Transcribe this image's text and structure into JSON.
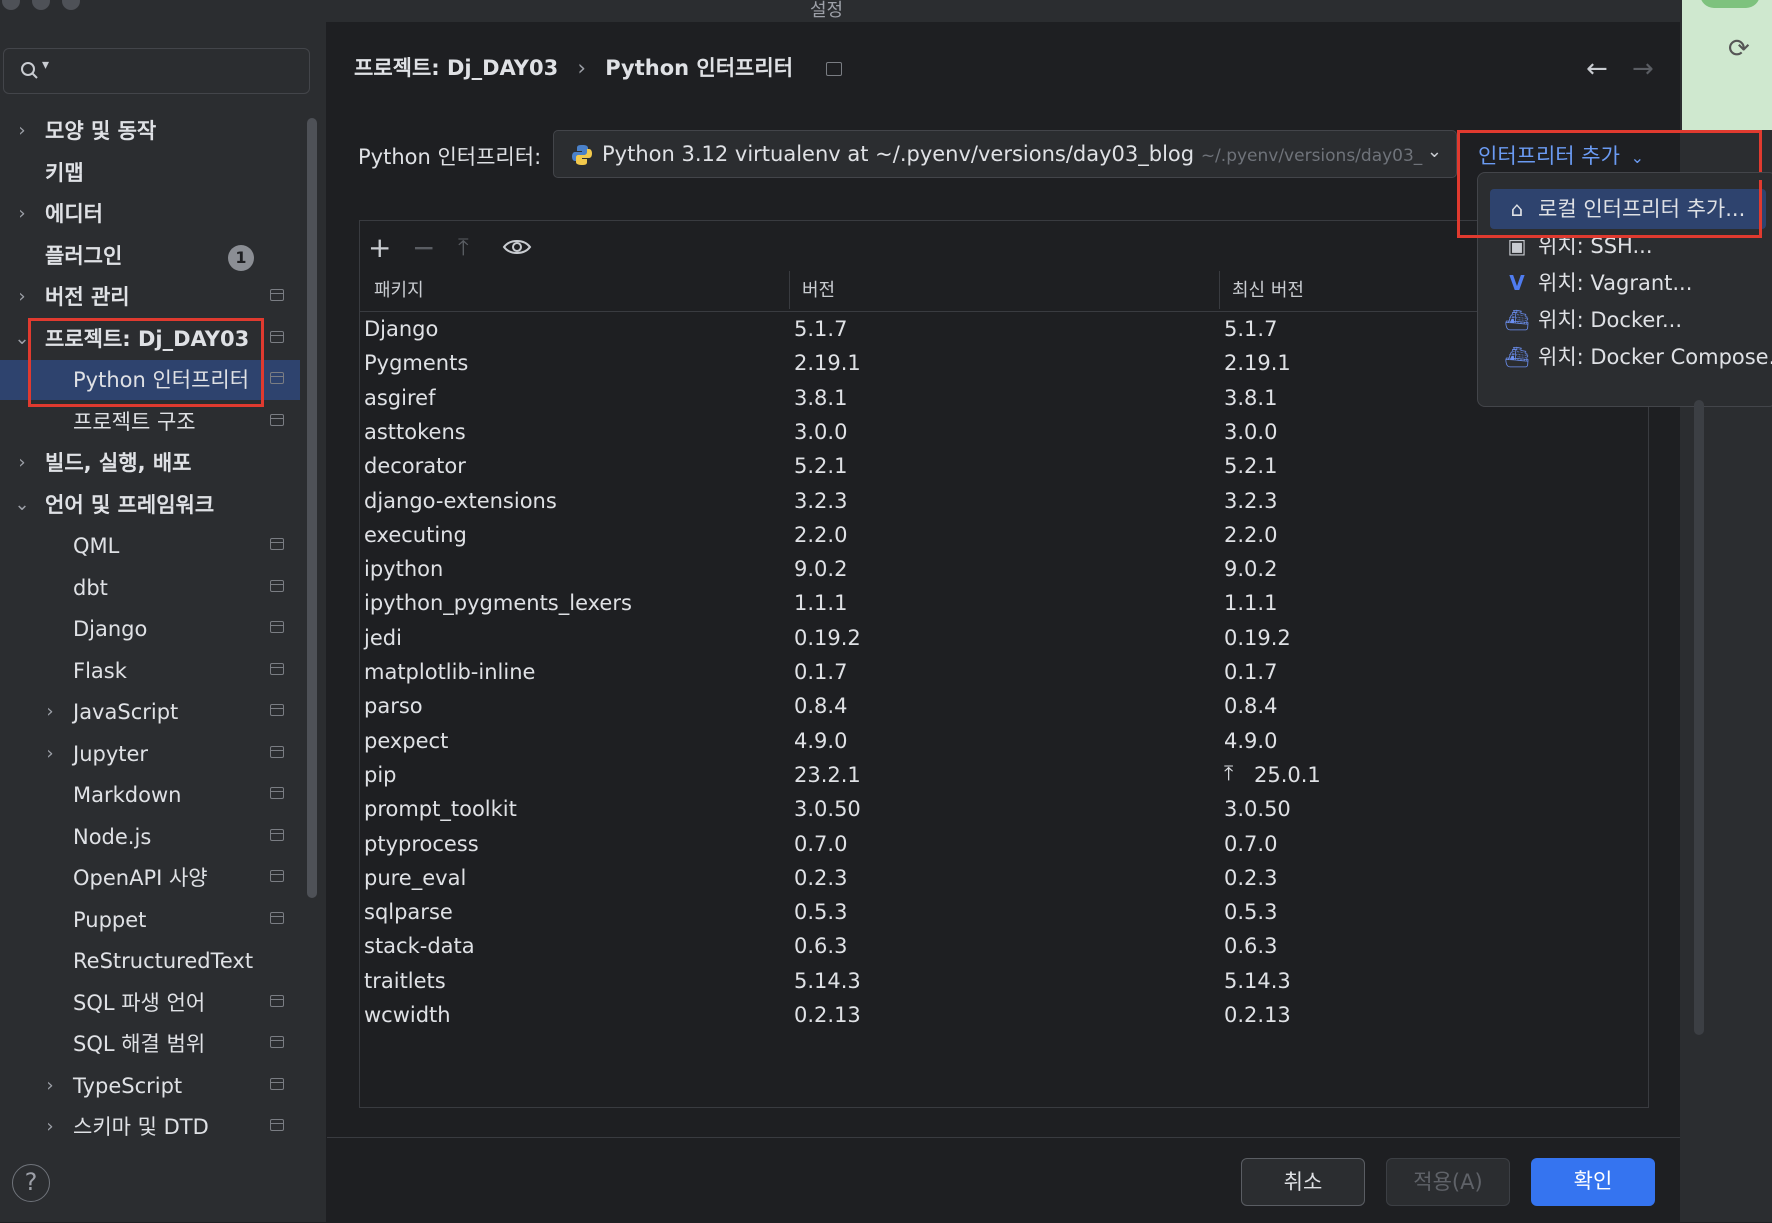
{
  "window": {
    "title": "설정"
  },
  "sidebar": {
    "search_placeholder": "",
    "items": [
      {
        "label": "모양 및 동작",
        "bold": true,
        "expand": "collapsed",
        "indent": 1,
        "project": false
      },
      {
        "label": "키맵",
        "bold": true,
        "expand": "none",
        "indent": 1,
        "project": false
      },
      {
        "label": "에디터",
        "bold": true,
        "expand": "collapsed",
        "indent": 1,
        "project": false
      },
      {
        "label": "플러그인",
        "bold": true,
        "expand": "none",
        "indent": 1,
        "project": false,
        "badge": "1"
      },
      {
        "label": "버전 관리",
        "bold": true,
        "expand": "collapsed",
        "indent": 1,
        "project": true
      },
      {
        "label": "프로젝트: Dj_DAY03",
        "bold": true,
        "expand": "expanded",
        "indent": 1,
        "project": true
      },
      {
        "label": "Python 인터프리터",
        "bold": false,
        "expand": "none",
        "indent": 2,
        "project": true,
        "selected": true
      },
      {
        "label": "프로젝트 구조",
        "bold": false,
        "expand": "none",
        "indent": 2,
        "project": true
      },
      {
        "label": "빌드, 실행, 배포",
        "bold": true,
        "expand": "collapsed",
        "indent": 1,
        "project": false
      },
      {
        "label": "언어 및 프레임워크",
        "bold": true,
        "expand": "expanded",
        "indent": 1,
        "project": false
      },
      {
        "label": "QML",
        "bold": false,
        "expand": "none",
        "indent": 2,
        "project": true
      },
      {
        "label": "dbt",
        "bold": false,
        "expand": "none",
        "indent": 2,
        "project": true
      },
      {
        "label": "Django",
        "bold": false,
        "expand": "none",
        "indent": 2,
        "project": true
      },
      {
        "label": "Flask",
        "bold": false,
        "expand": "none",
        "indent": 2,
        "project": true
      },
      {
        "label": "JavaScript",
        "bold": false,
        "expand": "collapsed",
        "indent": 2,
        "project": true
      },
      {
        "label": "Jupyter",
        "bold": false,
        "expand": "collapsed",
        "indent": 2,
        "project": true
      },
      {
        "label": "Markdown",
        "bold": false,
        "expand": "none",
        "indent": 2,
        "project": true
      },
      {
        "label": "Node.js",
        "bold": false,
        "expand": "none",
        "indent": 2,
        "project": true
      },
      {
        "label": "OpenAPI 사양",
        "bold": false,
        "expand": "none",
        "indent": 2,
        "project": true
      },
      {
        "label": "Puppet",
        "bold": false,
        "expand": "none",
        "indent": 2,
        "project": true
      },
      {
        "label": "ReStructuredText",
        "bold": false,
        "expand": "none",
        "indent": 2,
        "project": false
      },
      {
        "label": "SQL 파생 언어",
        "bold": false,
        "expand": "none",
        "indent": 2,
        "project": true
      },
      {
        "label": "SQL 해결 범위",
        "bold": false,
        "expand": "none",
        "indent": 2,
        "project": true
      },
      {
        "label": "TypeScript",
        "bold": false,
        "expand": "collapsed",
        "indent": 2,
        "project": true
      },
      {
        "label": "스키마 및 DTD",
        "bold": false,
        "expand": "collapsed",
        "indent": 2,
        "project": true
      }
    ]
  },
  "breadcrumb": {
    "project": "프로젝트: Dj_DAY03",
    "separator": "›",
    "page": "Python 인터프리터"
  },
  "interpreter": {
    "label": "Python 인터프리터:",
    "value": "Python 3.12 virtualenv at ~/.pyenv/versions/day03_blog",
    "path_hint": "~/.pyenv/versions/day03_",
    "add_label": "인터프리터 추가"
  },
  "table": {
    "columns": [
      "패키지",
      "버전",
      "최신 버전"
    ],
    "rows": [
      [
        "Django",
        "5.1.7",
        "5.1.7",
        false
      ],
      [
        "Pygments",
        "2.19.1",
        "2.19.1",
        false
      ],
      [
        "asgiref",
        "3.8.1",
        "3.8.1",
        false
      ],
      [
        "asttokens",
        "3.0.0",
        "3.0.0",
        false
      ],
      [
        "decorator",
        "5.2.1",
        "5.2.1",
        false
      ],
      [
        "django-extensions",
        "3.2.3",
        "3.2.3",
        false
      ],
      [
        "executing",
        "2.2.0",
        "2.2.0",
        false
      ],
      [
        "ipython",
        "9.0.2",
        "9.0.2",
        false
      ],
      [
        "ipython_pygments_lexers",
        "1.1.1",
        "1.1.1",
        false
      ],
      [
        "jedi",
        "0.19.2",
        "0.19.2",
        false
      ],
      [
        "matplotlib-inline",
        "0.1.7",
        "0.1.7",
        false
      ],
      [
        "parso",
        "0.8.4",
        "0.8.4",
        false
      ],
      [
        "pexpect",
        "4.9.0",
        "4.9.0",
        false
      ],
      [
        "pip",
        "23.2.1",
        "25.0.1",
        true
      ],
      [
        "prompt_toolkit",
        "3.0.50",
        "3.0.50",
        false
      ],
      [
        "ptyprocess",
        "0.7.0",
        "0.7.0",
        false
      ],
      [
        "pure_eval",
        "0.2.3",
        "0.2.3",
        false
      ],
      [
        "sqlparse",
        "0.5.3",
        "0.5.3",
        false
      ],
      [
        "stack-data",
        "0.6.3",
        "0.6.3",
        false
      ],
      [
        "traitlets",
        "5.14.3",
        "5.14.3",
        false
      ],
      [
        "wcwidth",
        "0.2.13",
        "0.2.13",
        false
      ]
    ]
  },
  "dropdown": {
    "items": [
      {
        "icon": "home-icon",
        "label": "로컬 인터프리터 추가...",
        "selected": true
      },
      {
        "icon": "terminal-icon",
        "label": "위치: SSH...",
        "selected": false
      },
      {
        "icon": "vagrant-icon",
        "label": "위치: Vagrant...",
        "selected": false
      },
      {
        "icon": "docker-icon",
        "label": "위치: Docker...",
        "selected": false
      },
      {
        "icon": "docker-icon",
        "label": "위치: Docker Compose...",
        "selected": false
      }
    ]
  },
  "footer": {
    "help": "?",
    "cancel": "취소",
    "apply": "적용(A)",
    "ok": "확인"
  },
  "colors": {
    "accent": "#3574f0",
    "selection": "#2e436e",
    "highlight_box": "#e03a2f",
    "link": "#6b9bf3"
  }
}
